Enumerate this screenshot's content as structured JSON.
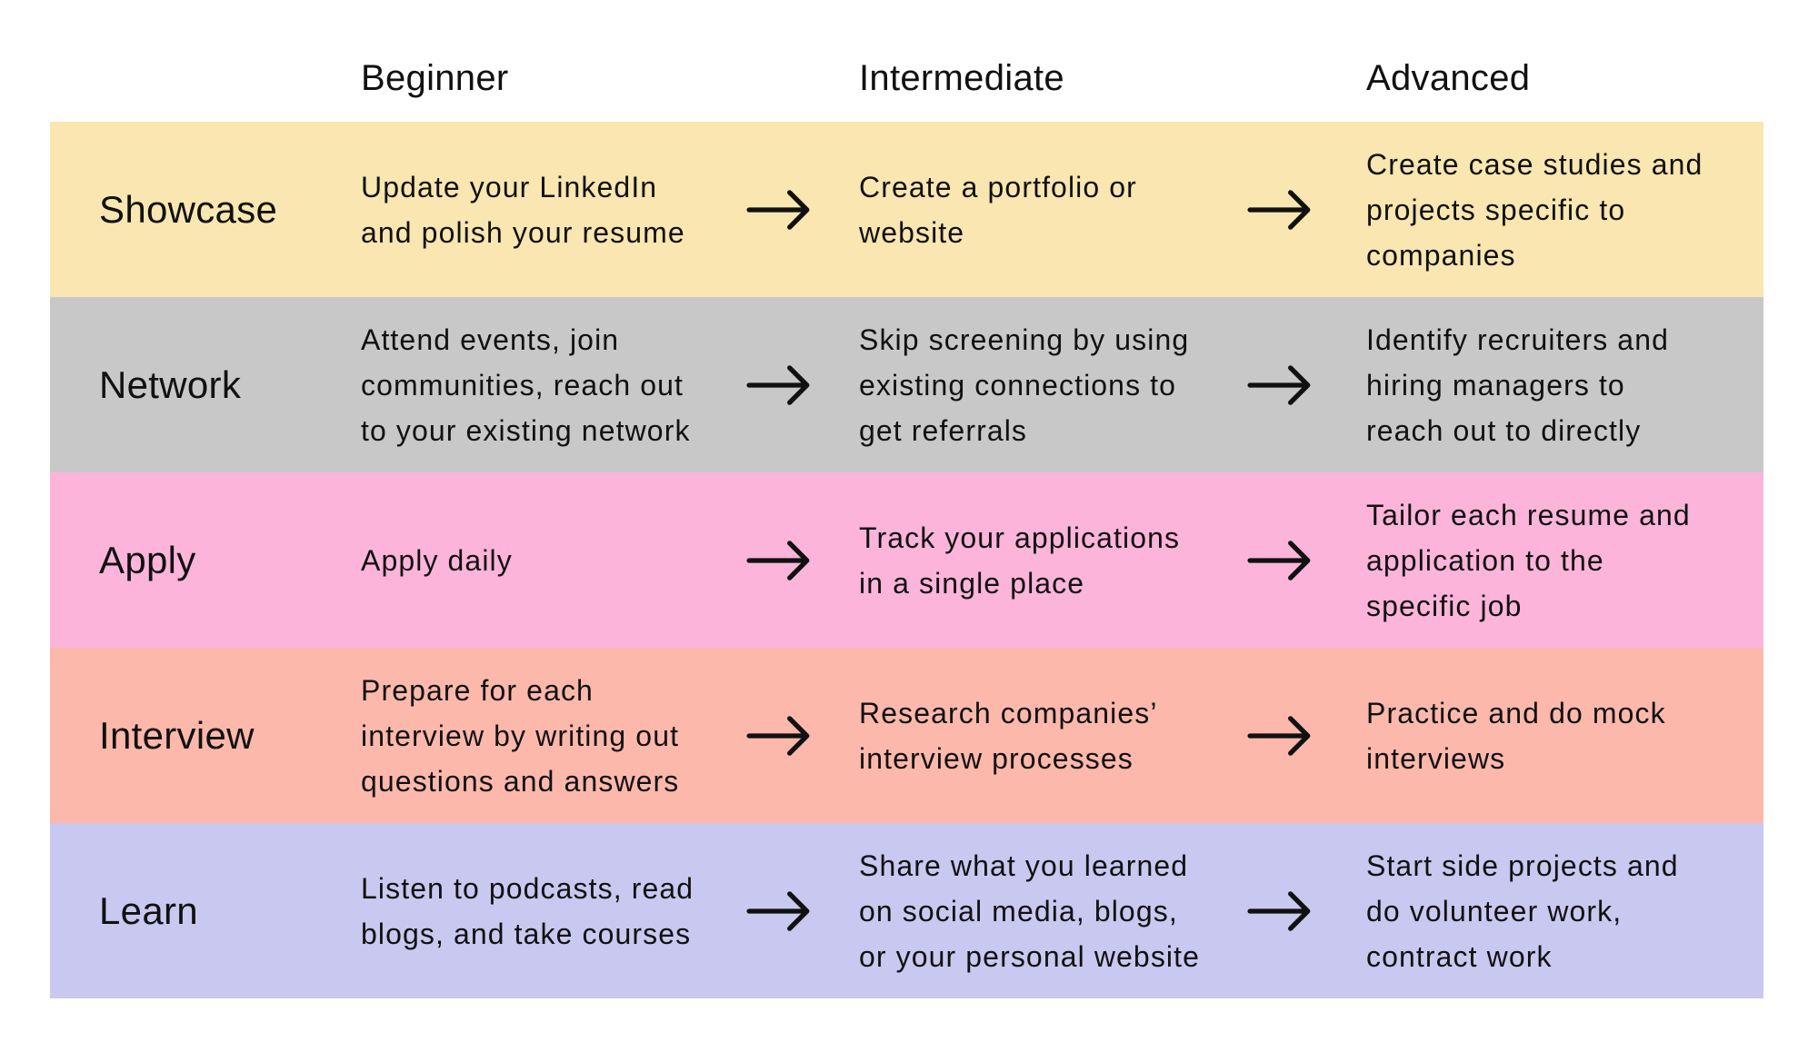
{
  "headers": {
    "beginner": "Beginner",
    "intermediate": "Intermediate",
    "advanced": "Advanced"
  },
  "arrow_icon": "right-arrow-icon",
  "rows": [
    {
      "label": "Showcase",
      "color": "#F9E6B0",
      "beginner": [
        "Update your LinkedIn",
        "and polish your resume"
      ],
      "intermediate": [
        "Create a portfolio or",
        "website"
      ],
      "advanced": [
        "Create case studies and",
        "projects specific to",
        "companies"
      ]
    },
    {
      "label": "Network",
      "color": "#C8C8C8",
      "beginner": [
        "Attend events, join",
        "communities, reach out",
        "to your existing network"
      ],
      "intermediate": [
        "Skip screening by using",
        "existing connections to",
        "get referrals"
      ],
      "advanced": [
        "Identify recruiters and",
        "hiring managers to",
        "reach out to directly"
      ]
    },
    {
      "label": "Apply",
      "color": "#FCB4DA",
      "beginner": [
        "Apply daily"
      ],
      "intermediate": [
        "Track your applications",
        "in a single place"
      ],
      "advanced": [
        "Tailor each resume and",
        "application to the",
        "specific job"
      ]
    },
    {
      "label": "Interview",
      "color": "#FDB8AC",
      "beginner": [
        "Prepare for each",
        "interview by writing out",
        "questions and answers"
      ],
      "intermediate": [
        "Research companies’",
        "interview processes"
      ],
      "advanced": [
        "Practice and do mock",
        "interviews"
      ]
    },
    {
      "label": "Learn",
      "color": "#C9C8F0",
      "beginner": [
        "Listen to podcasts, read",
        "blogs, and take courses"
      ],
      "intermediate": [
        "Share what you learned",
        "on social media, blogs,",
        "or your personal website"
      ],
      "advanced": [
        "Start side projects and",
        "do volunteer work,",
        "contract work"
      ]
    }
  ]
}
